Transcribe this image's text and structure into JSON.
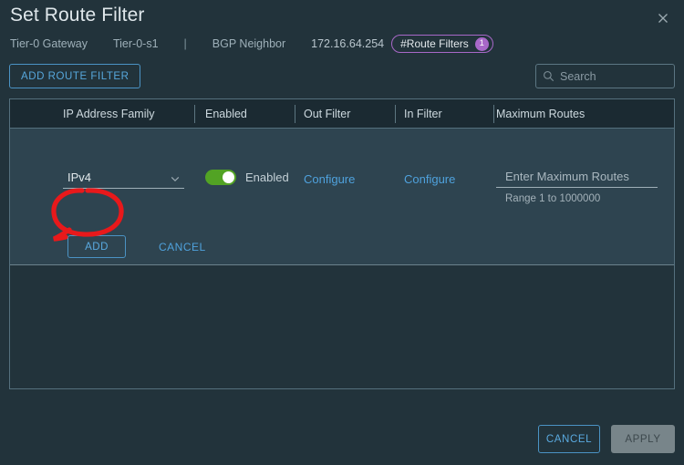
{
  "header": {
    "title": "Set Route Filter",
    "close_icon": "close-icon",
    "breadcrumb": {
      "gateway_label": "Tier-0 Gateway",
      "gateway_name": "Tier-0-s1",
      "separator": "|",
      "neighbor_label": "BGP Neighbor",
      "neighbor_ip": "172.16.64.254",
      "pill_label": "#Route Filters",
      "pill_count": "1",
      "pill_color": "#a868c8"
    }
  },
  "toolbar": {
    "add_route_filter_label": "ADD ROUTE FILTER",
    "search_placeholder": "Search",
    "search_value": "",
    "search_icon": "search-icon"
  },
  "table": {
    "columns": [
      "IP Address Family",
      "Enabled",
      "Out Filter",
      "In Filter",
      "Maximum Routes"
    ],
    "row": {
      "ip_address_family": "IPv4",
      "ip_family_chevron": "chevron-down-icon",
      "enabled_state": "Enabled",
      "enabled_toggle_on": true,
      "toggle_color": "#52a324",
      "out_filter_link": "Configure",
      "in_filter_link": "Configure",
      "maximum_routes_value": "",
      "maximum_routes_placeholder": "Enter Maximum Routes",
      "maximum_routes_hint": "Range 1 to 1000000"
    },
    "row_actions": {
      "add_label": "ADD",
      "cancel_label": "CANCEL"
    }
  },
  "footer": {
    "cancel_label": "CANCEL",
    "apply_label": "APPLY"
  },
  "annotation": {
    "shape": "hand-drawn-circle",
    "color": "#e8191b",
    "target": "add-button"
  }
}
